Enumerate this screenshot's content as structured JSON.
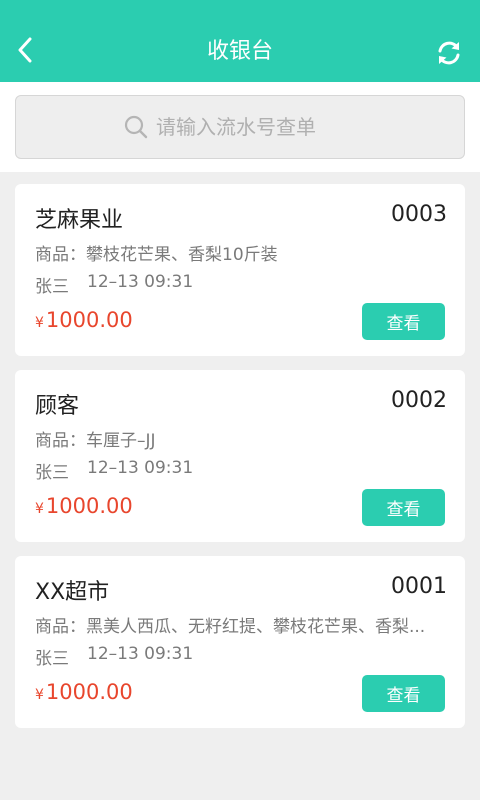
{
  "header": {
    "title": "收银台",
    "back_icon": "chevron-left-icon",
    "refresh_icon": "refresh-icon"
  },
  "search": {
    "placeholder": "请输入流水号查单",
    "icon": "search-icon"
  },
  "colors": {
    "accent": "#2bcdb0",
    "price": "#e8462d",
    "background": "#efefef"
  },
  "orders": [
    {
      "name": "芝麻果业",
      "number": "0003",
      "goods": "商品：攀枝花芒果、香梨10斤装",
      "cashier": "张三",
      "time": "12–13 09:31",
      "currency": "¥",
      "amount": "1000.00",
      "button": "查看"
    },
    {
      "name": "顾客",
      "number": "0002",
      "goods": "商品：车厘子–JJ",
      "cashier": "张三",
      "time": "12–13 09:31",
      "currency": "¥",
      "amount": "1000.00",
      "button": "查看"
    },
    {
      "name": "XX超市",
      "number": "0001",
      "goods": "商品：黑美人西瓜、无籽红提、攀枝花芒果、香梨...",
      "cashier": "张三",
      "time": "12–13 09:31",
      "currency": "¥",
      "amount": "1000.00",
      "button": "查看"
    }
  ]
}
